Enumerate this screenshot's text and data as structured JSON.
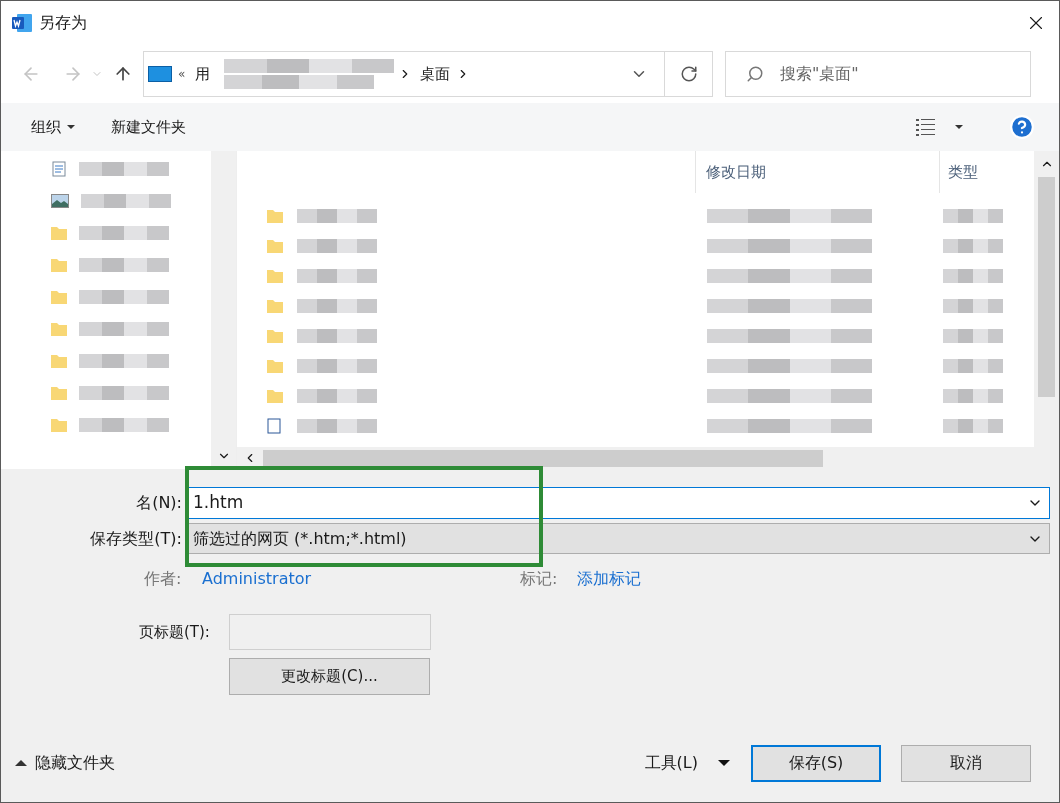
{
  "window": {
    "title": "另存为"
  },
  "address_bar": {
    "separator": "«",
    "segments": [
      "用",
      "桌面"
    ]
  },
  "search": {
    "placeholder": "搜索\"桌面\""
  },
  "toolbar": {
    "organize": "组织",
    "new_folder": "新建文件夹"
  },
  "nav_items": [
    {
      "kind": "document"
    },
    {
      "kind": "image"
    },
    {
      "kind": "folder"
    },
    {
      "kind": "folder"
    },
    {
      "kind": "folder"
    },
    {
      "kind": "folder"
    },
    {
      "kind": "folder"
    },
    {
      "kind": "folder"
    },
    {
      "kind": "folder"
    }
  ],
  "file_list": {
    "columns": [
      "修改日期",
      "类型"
    ],
    "rows": [
      {
        "kind": "folder"
      },
      {
        "kind": "folder"
      },
      {
        "kind": "folder"
      },
      {
        "kind": "folder"
      },
      {
        "kind": "folder"
      },
      {
        "kind": "folder"
      },
      {
        "kind": "folder"
      },
      {
        "kind": "file"
      }
    ]
  },
  "form": {
    "filename_label": "名(N):",
    "filename": "1.htm",
    "type_label": "保存类型(T):",
    "type_value": "筛选过的网页 (*.htm;*.html)",
    "author_label": "作者:",
    "author": "Administrator",
    "tags_label": "标记:",
    "tags_link": "添加标记",
    "page_title_label": "页标题(T):",
    "change_title_button": "更改标题(C)..."
  },
  "footer": {
    "hide_folders": "隐藏文件夹",
    "tools": "工具(L)",
    "save": "保存(S)",
    "cancel": "取消"
  }
}
